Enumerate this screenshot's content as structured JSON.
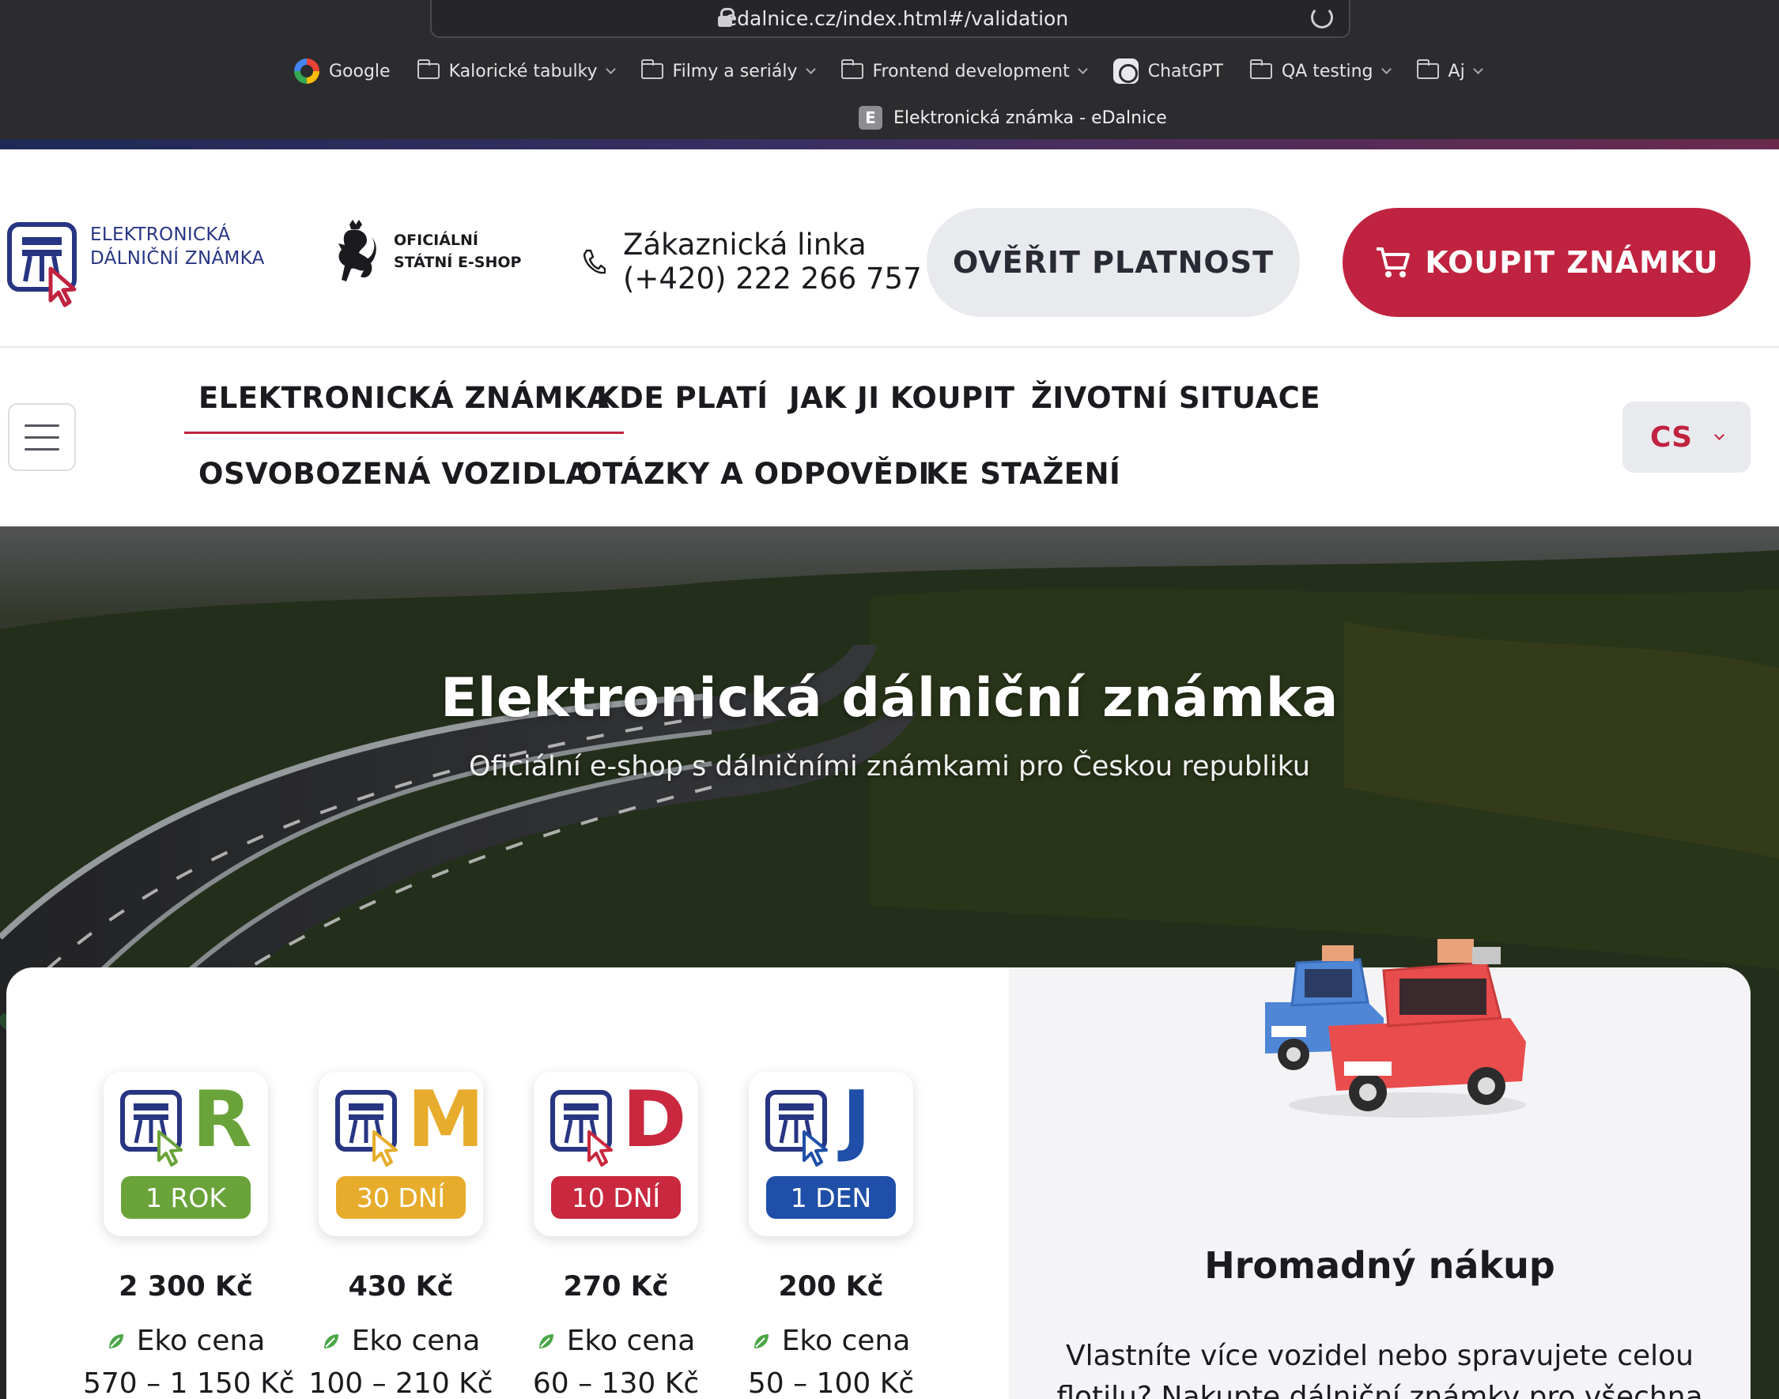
{
  "browser": {
    "url": "edalnice.cz/index.html#/validation",
    "bookmarks": [
      {
        "label": "Google",
        "icon": "google-icon",
        "folder": false
      },
      {
        "label": "Kalorické tabulky",
        "icon": "folder-icon",
        "folder": true
      },
      {
        "label": "Filmy a seriály",
        "icon": "folder-icon",
        "folder": true
      },
      {
        "label": "Frontend development",
        "icon": "folder-icon",
        "folder": true
      },
      {
        "label": "ChatGPT",
        "icon": "chatgpt-icon",
        "folder": false
      },
      {
        "label": "QA testing",
        "icon": "folder-icon",
        "folder": true
      },
      {
        "label": "Aj",
        "icon": "folder-icon",
        "folder": true
      }
    ],
    "tab_title": "Elektronická známka - eDalnice",
    "tab_favicon": "E"
  },
  "header": {
    "logo_line1": "ELEKTRONICKÁ",
    "logo_line2": "DÁLNIČNÍ ZNÁMKA",
    "state_line1": "OFICIÁLNÍ",
    "state_line2": "STÁTNÍ E-SHOP",
    "phone_label": "Zákaznická linka",
    "phone_number": "(+420) 222 266 757",
    "verify_label": "OVĚŘIT PLATNOST",
    "buy_label": "KOUPIT ZNÁMKU",
    "brand_color": "#c0233f",
    "logo_color": "#283583"
  },
  "nav": {
    "items": [
      {
        "label": "ELEKTRONICKÁ ZNÁMKA",
        "active": true
      },
      {
        "label": "KDE PLATÍ",
        "active": false
      },
      {
        "label": "JAK JI KOUPIT",
        "active": false
      },
      {
        "label": "ŽIVOTNÍ SITUACE",
        "active": false
      },
      {
        "label": "OSVOBOZENÁ VOZIDLA",
        "active": false
      },
      {
        "label": "OTÁZKY A ODPOVĚDI",
        "active": false
      },
      {
        "label": "KE STAŽENÍ",
        "active": false
      }
    ],
    "language": "CS"
  },
  "hero": {
    "title": "Elektronická dálniční známka",
    "subtitle": "Oficiální e-shop s dálničními známkami pro Českou republiku"
  },
  "vignettes": [
    {
      "letter": "R",
      "period": "1 ROK",
      "price": "2 300 Kč",
      "eko_label": "Eko cena",
      "eko_range": "570 – 1 150 Kč",
      "color": "#6aa33a"
    },
    {
      "letter": "M",
      "period": "30 DNÍ",
      "price": "430 Kč",
      "eko_label": "Eko cena",
      "eko_range": "100 – 210 Kč",
      "color": "#e7ac2c"
    },
    {
      "letter": "D",
      "period": "10 DNÍ",
      "price": "270 Kč",
      "eko_label": "Eko cena",
      "eko_range": "60 – 130 Kč",
      "color": "#c9283e"
    },
    {
      "letter": "J",
      "period": "1 DEN",
      "price": "200 Kč",
      "eko_label": "Eko cena",
      "eko_range": "50 – 100 Kč",
      "color": "#1f4fa8"
    }
  ],
  "bulk": {
    "title": "Hromadný nákup",
    "text_line1": "Vlastníte více vozidel nebo spravujete celou",
    "text_line2": "flotilu? Nakupte dálniční známky pro všechna"
  }
}
